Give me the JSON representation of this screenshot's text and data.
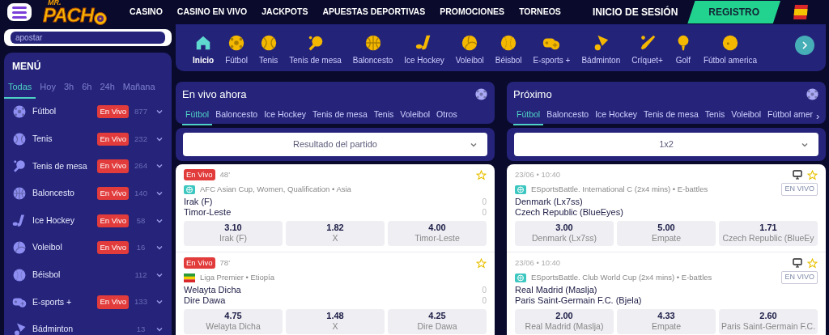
{
  "header": {
    "search_text": "apostar",
    "logo_top": "MR.",
    "logo": "PACH",
    "nav": [
      "CASINO",
      "CASINO EN VIVO",
      "JACKPOTS",
      "APUESTAS DEPORTIVAS",
      "PROMOCIONES",
      "TORNEOS"
    ],
    "login": "INICIO DE SESIÓN",
    "register": "REGISTRO"
  },
  "sports_bar": {
    "items": [
      {
        "label": "Inicio",
        "kind": "house",
        "selected": true
      },
      {
        "label": "Fútbol",
        "kind": "soccer",
        "selected": false
      },
      {
        "label": "Tenis",
        "kind": "tennis",
        "selected": false
      },
      {
        "label": "Tenis de mesa",
        "kind": "paddle",
        "selected": false
      },
      {
        "label": "Baloncesto",
        "kind": "basketball",
        "selected": false
      },
      {
        "label": "Ice Hockey",
        "kind": "hockey",
        "selected": false
      },
      {
        "label": "Voleibol",
        "kind": "volleyball",
        "selected": false
      },
      {
        "label": "Béisbol",
        "kind": "baseball",
        "selected": false
      },
      {
        "label": "E-sports +",
        "kind": "gamepad",
        "selected": false
      },
      {
        "label": "Bádminton",
        "kind": "shuttlecock",
        "selected": false
      },
      {
        "label": "Críquet+",
        "kind": "cricket",
        "selected": false
      },
      {
        "label": "Golf",
        "kind": "golf",
        "selected": false
      },
      {
        "label": "Fútbol america",
        "kind": "ball",
        "selected": false
      }
    ]
  },
  "sidebar": {
    "title": "MENÚ",
    "filters": [
      {
        "label": "Todas",
        "selected": true
      },
      {
        "label": "Hoy",
        "selected": false
      },
      {
        "label": "3h",
        "selected": false
      },
      {
        "label": "6h",
        "selected": false
      },
      {
        "label": "24h",
        "selected": false
      },
      {
        "label": "Mañana",
        "selected": false
      }
    ],
    "items": [
      {
        "label": "Fútbol",
        "kind": "soccer",
        "live": "En Vivo",
        "count": "877"
      },
      {
        "label": "Tenis",
        "kind": "tennis",
        "live": "En Vivo",
        "count": "232"
      },
      {
        "label": "Tenis de mesa",
        "kind": "paddle",
        "live": "En Vivo",
        "count": "264"
      },
      {
        "label": "Baloncesto",
        "kind": "basketball",
        "live": "En Vivo",
        "count": "140"
      },
      {
        "label": "Ice Hockey",
        "kind": "hockey",
        "live": "En Vivo",
        "count": "58"
      },
      {
        "label": "Voleibol",
        "kind": "volleyball",
        "live": "En Vivo",
        "count": "16"
      },
      {
        "label": "Béisbol",
        "kind": "baseball",
        "count": "112"
      },
      {
        "label": "E-sports +",
        "kind": "gamepad",
        "live": "En Vivo",
        "count": "133"
      },
      {
        "label": "Bádminton",
        "kind": "shuttlecock",
        "count": "13"
      }
    ]
  },
  "live": {
    "title": "En vivo ahora",
    "tabs": [
      {
        "label": "Fútbol",
        "selected": true
      },
      {
        "label": "Baloncesto",
        "selected": false
      },
      {
        "label": "Ice Hockey",
        "selected": false
      },
      {
        "label": "Tenis de mesa",
        "selected": false
      },
      {
        "label": "Tenis",
        "selected": false
      },
      {
        "label": "Voleibol",
        "selected": false
      },
      {
        "label": "Otros",
        "selected": false
      }
    ],
    "market": "Resultado del partido",
    "matches": [
      {
        "badge": "En Vivo",
        "minute": "48'",
        "league": {
          "kind": "globe",
          "text": "AFC Asian Cup, Women, Qualification • Asia"
        },
        "teams": [
          {
            "name": "Irak (F)",
            "score": "0"
          },
          {
            "name": "Timor-Leste",
            "score": "0"
          }
        ],
        "odds": [
          {
            "price": "3.10",
            "label": "Irak (F)"
          },
          {
            "price": "1.82",
            "label": "X"
          },
          {
            "price": "4.00",
            "label": "Timor-Leste"
          }
        ]
      },
      {
        "badge": "En Vivo",
        "minute": "78'",
        "league": {
          "kind": "ethiopia",
          "text": "Liga Premier • Etiopía"
        },
        "teams": [
          {
            "name": "Welayta Dicha",
            "score": "0"
          },
          {
            "name": "Dire Dawa",
            "score": "0"
          }
        ],
        "odds": [
          {
            "price": "4.75",
            "label": "Welayta Dicha"
          },
          {
            "price": "1.48",
            "label": "X"
          },
          {
            "price": "4.25",
            "label": "Dire Dawa"
          }
        ]
      }
    ]
  },
  "upcoming": {
    "title": "Próximo",
    "tabs": [
      {
        "label": "Fútbol",
        "selected": true
      },
      {
        "label": "Baloncesto",
        "selected": false
      },
      {
        "label": "Ice Hockey",
        "selected": false
      },
      {
        "label": "Tenis de mesa",
        "selected": false
      },
      {
        "label": "Tenis",
        "selected": false
      },
      {
        "label": "Voleibol",
        "selected": false
      },
      {
        "label": "Fútbol amer",
        "selected": false
      }
    ],
    "more": "›",
    "market": "1x2",
    "matches": [
      {
        "time": "23/06 • 10:40",
        "league": {
          "kind": "globe",
          "text": "ESportsBattle. International C (2x4 mins) • E-battles"
        },
        "tag": "EN VIVO",
        "teams": [
          {
            "name": "Denmark (Lx7ss)"
          },
          {
            "name": "Czech Republic (BlueEyes)"
          }
        ],
        "odds": [
          {
            "price": "3.00",
            "label": "Denmark (Lx7ss)"
          },
          {
            "price": "5.00",
            "label": "Empate"
          },
          {
            "price": "1.71",
            "label": "Czech Republic (BlueEy"
          }
        ]
      },
      {
        "time": "23/06 • 10:40",
        "league": {
          "kind": "globe",
          "text": "ESportsBattle. Club World Cup (2x4 mins) • E-battles"
        },
        "tag": "EN VIVO",
        "teams": [
          {
            "name": "Real Madrid (Maslja)"
          },
          {
            "name": "Paris Saint-Germain F.C. (Bjela)"
          }
        ],
        "odds": [
          {
            "price": "2.00",
            "label": "Real Madrid (Maslja)"
          },
          {
            "price": "4.33",
            "label": "Empate"
          },
          {
            "price": "2.60",
            "label": "Paris Saint-Germain F.C."
          }
        ]
      }
    ]
  }
}
